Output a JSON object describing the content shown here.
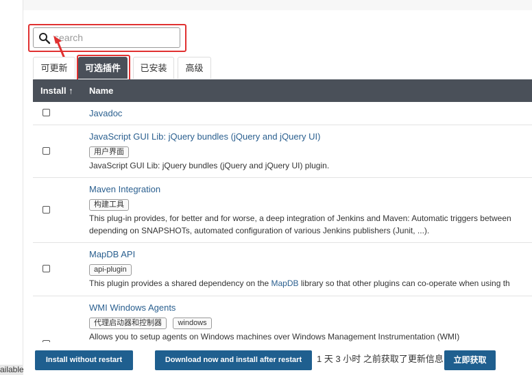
{
  "search": {
    "placeholder": "search",
    "value": ""
  },
  "tabs": [
    {
      "label": "可更新",
      "active": false
    },
    {
      "label": "可选插件",
      "active": true
    },
    {
      "label": "已安装",
      "active": false
    },
    {
      "label": "高级",
      "active": false
    }
  ],
  "table": {
    "headers": {
      "install": "Install ↑",
      "name": "Name"
    },
    "rows": [
      {
        "name": "Javadoc",
        "tags": [],
        "description": ""
      },
      {
        "name": "JavaScript GUI Lib: jQuery bundles (jQuery and jQuery UI)",
        "tags": [
          "用户界面"
        ],
        "description": "JavaScript GUI Lib: jQuery bundles (jQuery and jQuery UI) plugin."
      },
      {
        "name": "Maven Integration",
        "tags": [
          "构建工具"
        ],
        "description": "This plug-in provides, for better and for worse, a deep integration of Jenkins and Maven: Automatic triggers between",
        "description2": "depending on SNAPSHOTs, automated configuration of various Jenkins publishers (Junit, ...)."
      },
      {
        "name": "MapDB API",
        "tags": [
          "api-plugin"
        ],
        "description_pre": "This plugin provides a shared dependency on the ",
        "description_link": "MapDB",
        "description_post": " library so that other plugins can co-operate when using th"
      },
      {
        "name": "WMI Windows Agents",
        "tags": [
          "代理启动器和控制器",
          "windows"
        ],
        "description": "Allows you to setup agents on Windows machines over Windows Management Instrumentation (WMI)"
      }
    ]
  },
  "footer": {
    "install_without_restart": "Install without restart",
    "download_install_after_restart": "Download now and install after restart",
    "status": "1 天 3 小时 之前获取了更新信息",
    "fetch_now": "立即获取"
  },
  "sidebar": {
    "available_label": "ailable"
  },
  "colors": {
    "accent": "#1f5f8f",
    "header": "#4a5059",
    "highlight": "#e03030",
    "link": "#2a5f8f"
  }
}
